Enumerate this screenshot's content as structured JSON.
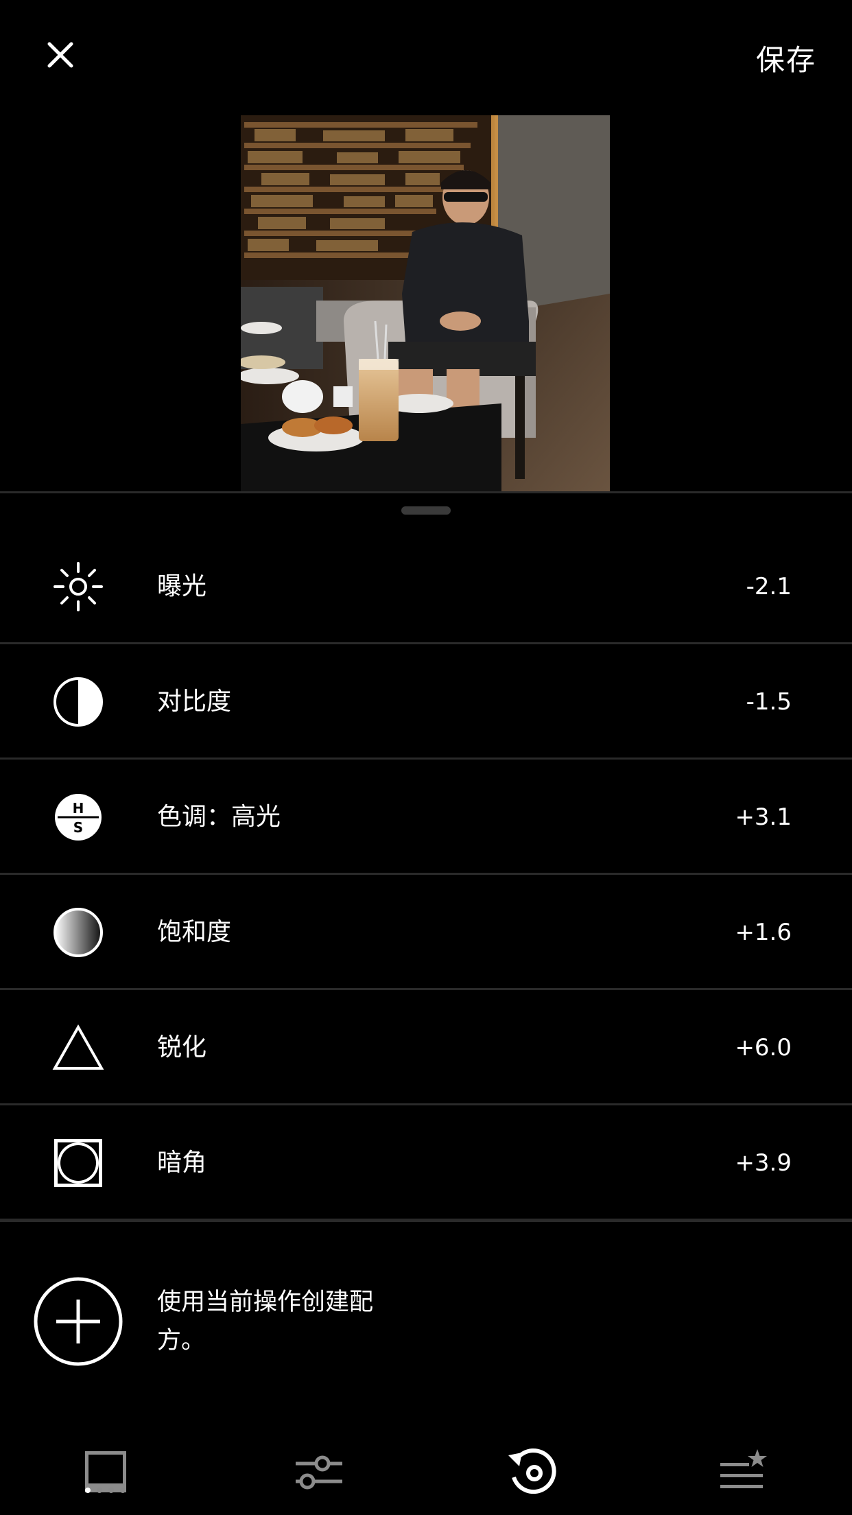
{
  "header": {
    "save_label": "保存",
    "close_icon": "close-icon"
  },
  "adjustments": [
    {
      "icon": "exposure-sun-icon",
      "label": "曝光",
      "value": "-2.1"
    },
    {
      "icon": "contrast-half-circle-icon",
      "label": "对比度",
      "value": "-1.5"
    },
    {
      "icon": "tone-hs-icon",
      "label": "色调：高光",
      "value": "+3.1"
    },
    {
      "icon": "saturation-gradient-icon",
      "label": "饱和度",
      "value": "+1.6"
    },
    {
      "icon": "sharpen-triangle-icon",
      "label": "锐化",
      "value": "+6.0"
    },
    {
      "icon": "vignette-icon",
      "label": "暗角",
      "value": "+3.9"
    }
  ],
  "recipe": {
    "text": "使用当前操作创建配方。"
  },
  "tabs": [
    {
      "icon": "presets-icon",
      "active": false
    },
    {
      "icon": "sliders-icon",
      "active": false
    },
    {
      "icon": "history-icon",
      "active": true
    },
    {
      "icon": "recipes-icon",
      "active": false
    }
  ],
  "tab_indicator": {
    "count": 4,
    "active_index": 0
  }
}
